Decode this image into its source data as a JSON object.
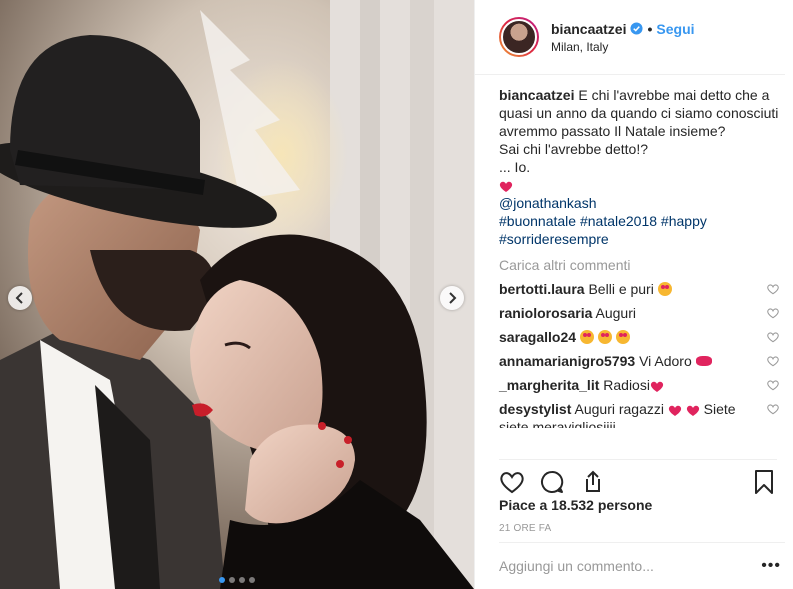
{
  "header": {
    "username": "biancaatzei",
    "separator": "•",
    "follow_label": "Segui",
    "location": "Milan, Italy"
  },
  "caption": {
    "username": "biancaatzei",
    "text_line1": "E chi l'avrebbe mai detto che a quasi un anno da quando ci siamo conosciuti avremmo passato Il Natale insieme?",
    "text_line2": "Sai chi l'avrebbe detto!?",
    "text_line3": "... Io.",
    "mention": "@jonathankash",
    "hashtags_line1": "#buonnatale #natale2018 #happy",
    "hashtags_line2": "#sorrideresempre"
  },
  "load_more": "Carica altri commenti",
  "comments": [
    {
      "user": "bertotti.laura",
      "text": "Belli e puri"
    },
    {
      "user": "raniolorosaria",
      "text": "Auguri"
    },
    {
      "user": "saragallo24",
      "text": ""
    },
    {
      "user": "annamarianigro5793",
      "text": "Vi Adoro"
    },
    {
      "user": "_margherita_lit",
      "text": "Radiosi"
    },
    {
      "user": "desystylist",
      "text": "Auguri ragazzi",
      "text2": "Siete siete meravigliosiiii"
    }
  ],
  "likes": "Piace a 18.532 persone",
  "time": "21 ORE FA",
  "add_comment_placeholder": "Aggiungi un commento...",
  "more_label": "•••",
  "carousel": {
    "count": 4,
    "active": 1
  },
  "icons": [
    "verified-icon",
    "heart-icon",
    "comment-icon",
    "share-icon",
    "bookmark-icon",
    "chevron-left-icon",
    "chevron-right-icon"
  ],
  "colors": {
    "accent": "#3897f0",
    "link": "#003569",
    "muted": "#999999",
    "heart": "#ed4956"
  }
}
